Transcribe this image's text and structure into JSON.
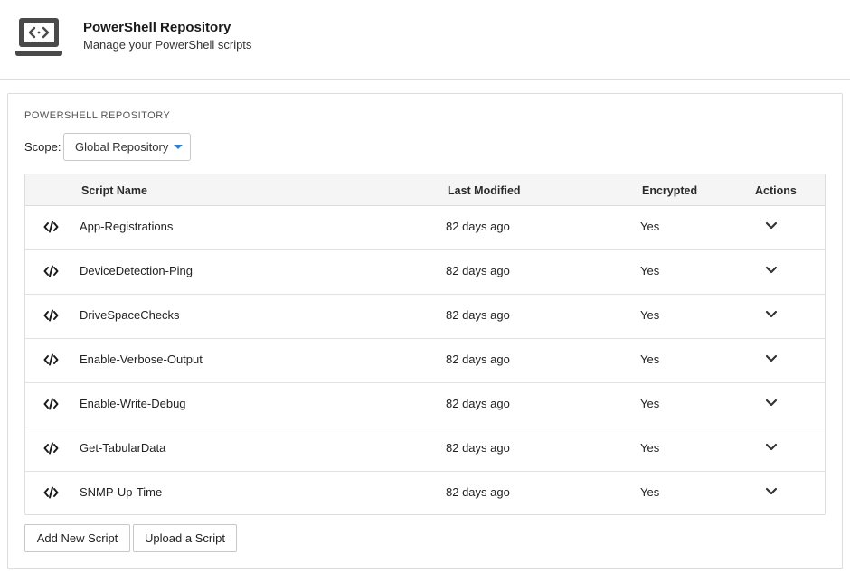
{
  "header": {
    "icon": "laptop-code-icon",
    "title": "PowerShell Repository",
    "subtitle": "Manage your PowerShell scripts"
  },
  "panel": {
    "section_label": "POWERSHELL REPOSITORY",
    "scope_label": "Scope:",
    "scope_value": "Global Repository",
    "accent_color": "#2f7fd0"
  },
  "table": {
    "columns": {
      "name": "Script Name",
      "modified": "Last Modified",
      "encrypted": "Encrypted",
      "actions": "Actions"
    },
    "rows": [
      {
        "name": "App-Registrations",
        "modified": "82 days ago",
        "encrypted": "Yes"
      },
      {
        "name": "DeviceDetection-Ping",
        "modified": "82 days ago",
        "encrypted": "Yes"
      },
      {
        "name": "DriveSpaceChecks",
        "modified": "82 days ago",
        "encrypted": "Yes"
      },
      {
        "name": "Enable-Verbose-Output",
        "modified": "82 days ago",
        "encrypted": "Yes"
      },
      {
        "name": "Enable-Write-Debug",
        "modified": "82 days ago",
        "encrypted": "Yes"
      },
      {
        "name": "Get-TabularData",
        "modified": "82 days ago",
        "encrypted": "Yes"
      },
      {
        "name": "SNMP-Up-Time",
        "modified": "82 days ago",
        "encrypted": "Yes"
      }
    ]
  },
  "buttons": {
    "add_label": "Add New Script",
    "upload_label": "Upload a Script"
  }
}
